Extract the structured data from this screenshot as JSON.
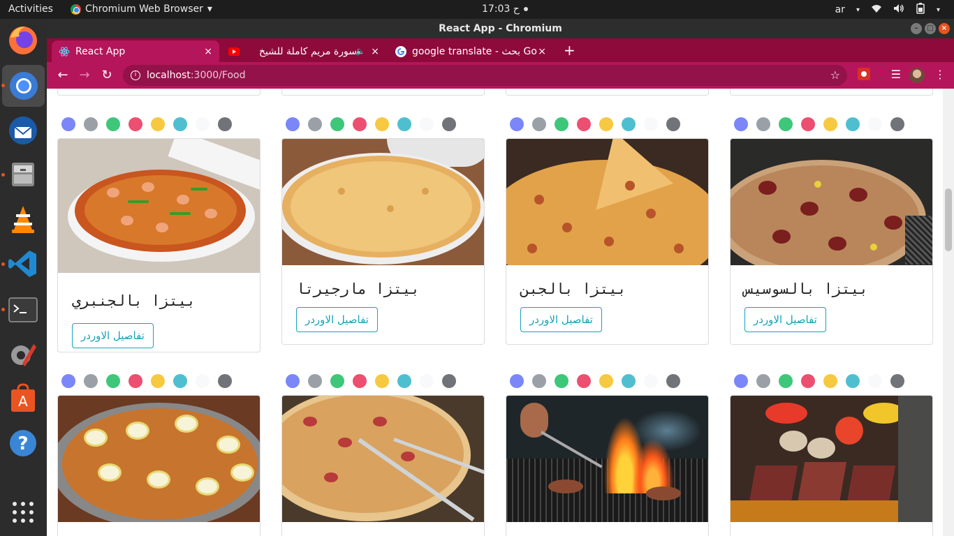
{
  "system": {
    "activities": "Activities",
    "app_menu": "Chromium Web Browser",
    "clock": "17:03 ح",
    "keyboard_layout": "ar"
  },
  "window": {
    "title": "React App - Chromium"
  },
  "tabs": [
    {
      "label": "React App",
      "close": "×"
    },
    {
      "label": "سورة مريم كاملة للشيخ",
      "close": "×"
    },
    {
      "label": "google translate - بحث Go",
      "close": "×"
    }
  ],
  "new_tab": "+",
  "address": {
    "host": "localhost",
    "path": ":3000/Food"
  },
  "color_dots": [
    "#7b86f8",
    "#9aa0a6",
    "#3ec77a",
    "#ec4f6f",
    "#f7c940",
    "#4fbfd0",
    "#f8f9fa",
    "#707378"
  ],
  "cards_row1": [
    {
      "title": "بيتزا بالجنبري",
      "button": "تفاصيل الاوردر"
    },
    {
      "title": "بيتزا مارجيرتا",
      "button": "تفاصيل الاوردر"
    },
    {
      "title": "بيتزا بالجبن",
      "button": "تفاصيل الاوردر"
    },
    {
      "title": "بيتزا بالسوسيس",
      "button": "تفاصيل الاوردر"
    }
  ],
  "cards_row2": [
    {
      "image": "pizza-eggs"
    },
    {
      "image": "pizza-pepperoni-fork"
    },
    {
      "image": "grill-fire"
    },
    {
      "image": "steak-vegetables"
    }
  ]
}
